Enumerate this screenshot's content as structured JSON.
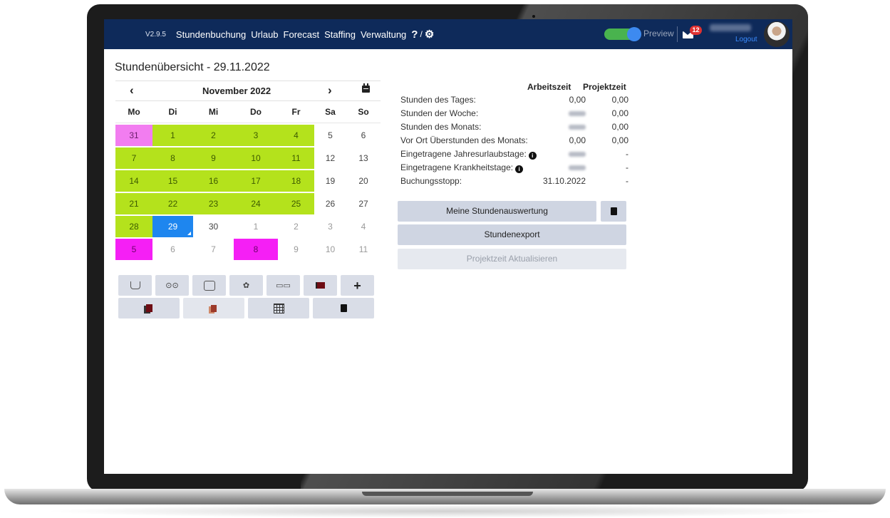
{
  "nav": {
    "version": "V2.9.5",
    "items": [
      "Stundenbuchung",
      "Urlaub",
      "Forecast",
      "Staffing",
      "Verwaltung"
    ],
    "help": "?",
    "separator": "/",
    "preview_label": "Preview",
    "preview_enabled": true,
    "mail_count": "12",
    "logout": "Logout"
  },
  "page_title": "Stundenübersicht - 29.11.2022",
  "calendar": {
    "prev": "‹",
    "next": "›",
    "month": "November 2022",
    "weekdays": [
      "Mo",
      "Di",
      "Mi",
      "Do",
      "Fr",
      "Sa",
      "So"
    ],
    "weeks": [
      [
        {
          "d": "31",
          "s": "pink"
        },
        {
          "d": "1",
          "s": "green"
        },
        {
          "d": "2",
          "s": "green"
        },
        {
          "d": "3",
          "s": "green"
        },
        {
          "d": "4",
          "s": "green"
        },
        {
          "d": "5",
          "s": ""
        },
        {
          "d": "6",
          "s": ""
        }
      ],
      [
        {
          "d": "7",
          "s": "green"
        },
        {
          "d": "8",
          "s": "green"
        },
        {
          "d": "9",
          "s": "green"
        },
        {
          "d": "10",
          "s": "green"
        },
        {
          "d": "11",
          "s": "green"
        },
        {
          "d": "12",
          "s": ""
        },
        {
          "d": "13",
          "s": ""
        }
      ],
      [
        {
          "d": "14",
          "s": "green"
        },
        {
          "d": "15",
          "s": "green"
        },
        {
          "d": "16",
          "s": "green"
        },
        {
          "d": "17",
          "s": "green"
        },
        {
          "d": "18",
          "s": "green"
        },
        {
          "d": "19",
          "s": ""
        },
        {
          "d": "20",
          "s": ""
        }
      ],
      [
        {
          "d": "21",
          "s": "green"
        },
        {
          "d": "22",
          "s": "green"
        },
        {
          "d": "23",
          "s": "green"
        },
        {
          "d": "24",
          "s": "green"
        },
        {
          "d": "25",
          "s": "green"
        },
        {
          "d": "26",
          "s": ""
        },
        {
          "d": "27",
          "s": ""
        }
      ],
      [
        {
          "d": "28",
          "s": "green"
        },
        {
          "d": "29",
          "s": "sel"
        },
        {
          "d": "30",
          "s": ""
        },
        {
          "d": "1",
          "s": "mute"
        },
        {
          "d": "2",
          "s": "mute"
        },
        {
          "d": "3",
          "s": "mute"
        },
        {
          "d": "4",
          "s": "mute"
        }
      ],
      [
        {
          "d": "5",
          "s": "magenta"
        },
        {
          "d": "6",
          "s": "mute"
        },
        {
          "d": "7",
          "s": "mute"
        },
        {
          "d": "8",
          "s": "magenta"
        },
        {
          "d": "9",
          "s": "mute"
        },
        {
          "d": "10",
          "s": "mute"
        },
        {
          "d": "11",
          "s": "mute"
        }
      ]
    ]
  },
  "tools": {
    "row1": [
      "coffee-break-icon",
      "lunch-icon",
      "work-bag-icon",
      "vacation-palm-icon",
      "training-icon",
      "flag-icon",
      "add-icon"
    ],
    "row2": [
      "copy-icon",
      "paste-icon",
      "grid-edit-icon",
      "pdf-icon"
    ],
    "plus_label": "+"
  },
  "stats": {
    "col_work": "Arbeitszeit",
    "col_project": "Projektzeit",
    "rows": [
      {
        "label": "Stunden des Tages:",
        "work": "0,00",
        "project": "0,00"
      },
      {
        "label": "Stunden der Woche:",
        "work": "",
        "project": "0,00"
      },
      {
        "label": "Stunden des Monats:",
        "work": "",
        "project": "0,00"
      },
      {
        "label": "Vor Ort Überstunden des Monats:",
        "work": "0,00",
        "project": "0,00"
      },
      {
        "label": "Eingetragene Jahresurlaubstage:",
        "work": "",
        "project": "-"
      },
      {
        "label": "Eingetragene Krankheitstage:",
        "work": "",
        "project": "-"
      },
      {
        "label": "Buchungsstopp:",
        "work": "31.10.2022",
        "project": "-"
      }
    ]
  },
  "buttons": {
    "evaluation": "Meine Stundenauswertung",
    "export": "Stundenexport",
    "update": "Projektzeit Aktualisieren"
  },
  "colors": {
    "nav_bg": "#0e2a5a",
    "booked_day": "#b4e21c",
    "holiday_day": "#f27df0",
    "absence_day": "#f51ff5",
    "selected_day": "#1e86ef"
  }
}
